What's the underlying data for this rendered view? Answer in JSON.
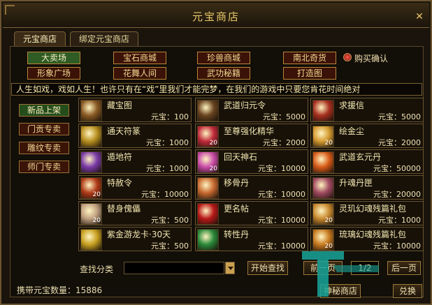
{
  "window": {
    "title": "元宝商店",
    "close_symbol": "✕"
  },
  "tabs": [
    {
      "label": "元宝商店",
      "active": true
    },
    {
      "label": "绑定元宝商店",
      "active": false
    }
  ],
  "categories": [
    {
      "label": "大卖场",
      "active": true
    },
    {
      "label": "宝石商城",
      "active": false
    },
    {
      "label": "珍兽商城",
      "active": false
    },
    {
      "label": "南北奇货",
      "active": false
    },
    {
      "label": "形象广场",
      "active": false
    },
    {
      "label": "花舞人间",
      "active": false
    },
    {
      "label": "武功秘籍",
      "active": false
    },
    {
      "label": "打造图",
      "active": false
    }
  ],
  "purchase_confirm": {
    "label": "购买确认"
  },
  "marquee": {
    "text": "人生如戏，戏如人生！也许只有在“戏”里我们才能完梦，在我们的游戏中只要您肯花时间绝对"
  },
  "side_menu": [
    {
      "label": "新品上架",
      "active": true
    },
    {
      "label": "门贡专卖",
      "active": false
    },
    {
      "label": "雕纹专卖",
      "active": false
    },
    {
      "label": "师门专卖",
      "active": false
    }
  ],
  "items": [
    {
      "name": "藏宝图",
      "price": "元宝：100",
      "qty": "",
      "icon": "treasure-map-icon",
      "color": "#8a5a24"
    },
    {
      "name": "武道归元令",
      "price": "元宝：5000",
      "qty": "",
      "icon": "token-icon",
      "color": "#6a4420"
    },
    {
      "name": "求援信",
      "price": "元宝：5000",
      "qty": "",
      "icon": "letter-icon",
      "color": "#a83020"
    },
    {
      "name": "通天符篆",
      "price": "元宝：1000",
      "qty": "",
      "icon": "talisman-icon",
      "color": "#b89020"
    },
    {
      "name": "至尊强化精华",
      "price": "元宝：2000",
      "qty": "20",
      "icon": "essence-icon",
      "color": "#c02a3a"
    },
    {
      "name": "绘金尘",
      "price": "元宝：2000",
      "qty": "20",
      "icon": "gold-dust-icon",
      "color": "#d49a30"
    },
    {
      "name": "遁地符",
      "price": "元宝：1000",
      "qty": "",
      "icon": "escape-talisman-icon",
      "color": "#7a3aa8"
    },
    {
      "name": "回天神石",
      "price": "元宝：10000",
      "qty": "20",
      "icon": "stone-icon",
      "color": "#c84aa8"
    },
    {
      "name": "武道玄元丹",
      "price": "元宝：50000",
      "qty": "",
      "icon": "elixir-icon",
      "color": "#d85a18"
    },
    {
      "name": "特赦令",
      "price": "元宝：10000",
      "qty": "20",
      "icon": "pardon-icon",
      "color": "#b03a18"
    },
    {
      "name": "移骨丹",
      "price": "元宝：10000",
      "qty": "",
      "icon": "pill-icon",
      "color": "#c86a30"
    },
    {
      "name": "升魂丹匣",
      "price": "元宝：20000",
      "qty": "",
      "icon": "box-icon",
      "color": "#a04a60"
    },
    {
      "name": "替身傀儡",
      "price": "元宝：500",
      "qty": "20",
      "icon": "puppet-icon",
      "color": "#c0a080"
    },
    {
      "name": "更名帖",
      "price": "元宝：10000",
      "qty": "",
      "icon": "rename-card-icon",
      "color": "#b81818"
    },
    {
      "name": "灵玑幻魂残篇礼包",
      "price": "元宝：1000",
      "qty": "20",
      "icon": "gift-pack-icon",
      "color": "#c88a30"
    },
    {
      "name": "紫金游龙卡·30天",
      "price": "元宝：500",
      "qty": "",
      "icon": "dragon-card-icon",
      "color": "#c8a020"
    },
    {
      "name": "转性丹",
      "price": "元宝：10000",
      "qty": "",
      "icon": "gender-pill-icon",
      "color": "#2a8a3a"
    },
    {
      "name": "琉璃幻魂残篇礼包",
      "price": "元宝：10000",
      "qty": "20",
      "icon": "gift-pack-icon",
      "color": "#c87a20"
    }
  ],
  "search": {
    "label": "查找分类",
    "value": "",
    "start_label": "开始查找",
    "prev_label": "前一页",
    "page": "1/2",
    "next_label": "后一页"
  },
  "footer": {
    "balance_label": "携带元宝数量：",
    "balance_value": "15886",
    "secret_shop_label": "神秘商店",
    "exchange_label": "兑换"
  }
}
